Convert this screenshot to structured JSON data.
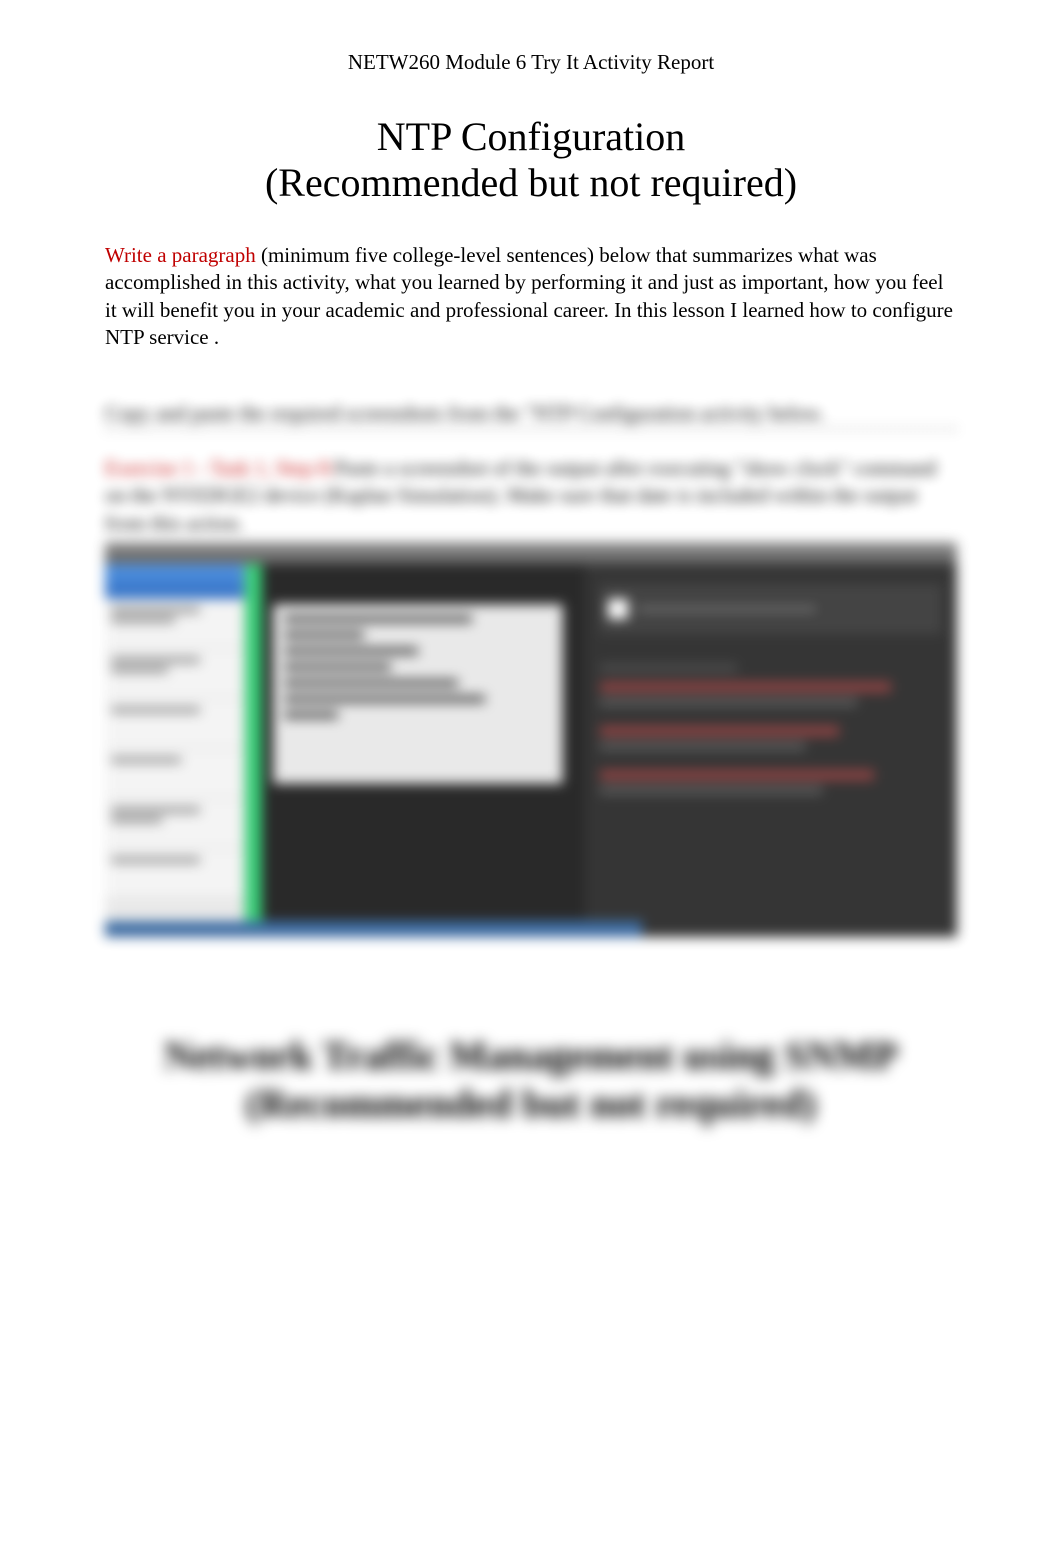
{
  "header": "NETW260 Module 6 Try It Activity Report",
  "section1": {
    "title_line1": "NTP Configuration",
    "title_line2": "(Recommended but not required)",
    "prompt_red": "Write a paragraph",
    "prompt_body": "  (minimum five college-level sentences) below that summarizes what was accomplished in this activity, what you learned by performing it and just as important, how you feel it will benefit you in your academic and professional career. In this lesson I learned how to configure NTP service .",
    "instruction": "Copy and paste the required screenshots from the \"NTP Configuration activity below.",
    "exercise_red": "Exercise 1 - Task 1, Step 8:",
    "exercise_body": "Paste a screenshot of the output after executing \"show clock\" command on the NYEDGE2 device (Kaplan Simulation). Make sure that date is included within the output from this action."
  },
  "section2": {
    "title_line1": "Network Traffic Management using SNMP",
    "title_line2": "(Recommended but not required)"
  }
}
